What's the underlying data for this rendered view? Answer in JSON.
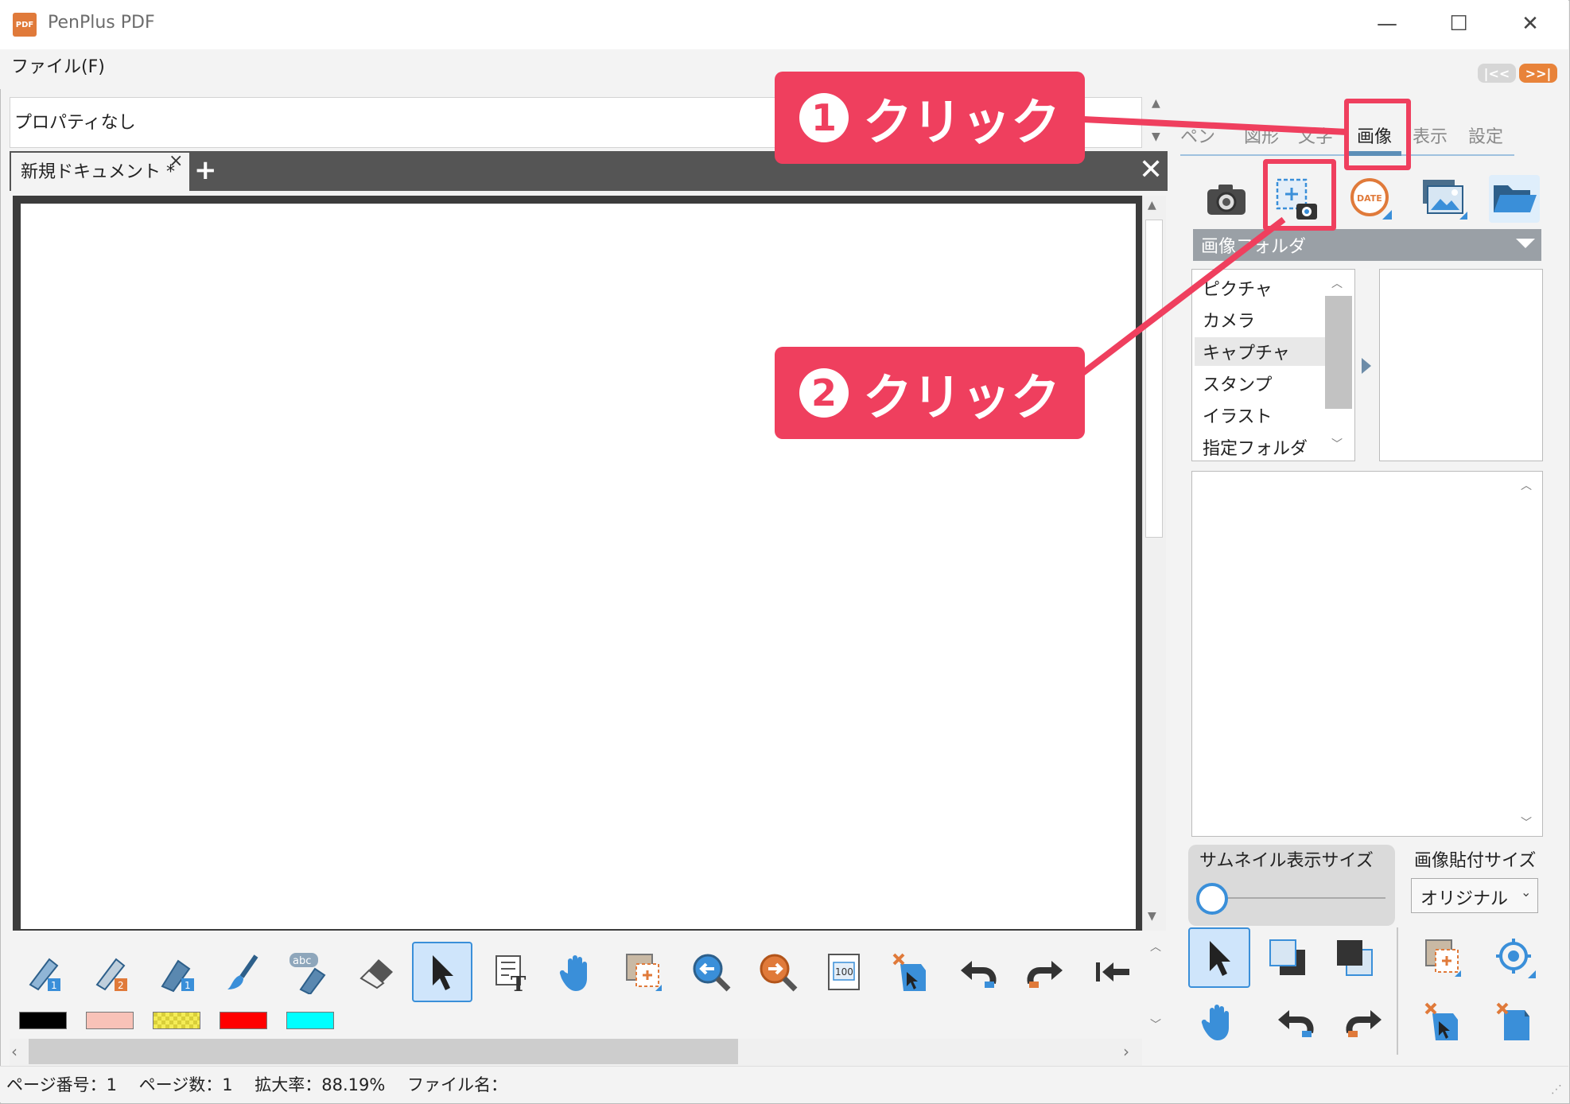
{
  "window": {
    "title": "PenPlus PDF",
    "app_icon_text": "PDF",
    "minimize": "—",
    "maximize": "☐",
    "close": "✕"
  },
  "menu": {
    "file": "ファイル(F)"
  },
  "nav": {
    "prev": "|<<",
    "next": ">>|"
  },
  "properties": {
    "text": "プロパティなし"
  },
  "document_tab": {
    "label": "新規ドキュメント *",
    "close": "×",
    "add": "+",
    "close_all": "✕"
  },
  "toolbar": {
    "tools": [
      "pen-1-icon",
      "pen-2-icon",
      "marker-1-icon",
      "brush-icon",
      "text-marker-icon",
      "eraser-icon",
      "select-arrow-icon",
      "text-box-icon",
      "hand-icon",
      "area-capture-icon",
      "zoom-out-icon",
      "zoom-in-icon",
      "fit-100-icon",
      "delete-object-icon",
      "undo-icon",
      "redo-icon",
      "go-first-icon"
    ],
    "swatches": [
      "#000000",
      "#f8c2b8",
      "#f4ec56",
      "#ff0000",
      "#00ffff"
    ]
  },
  "status": {
    "text": "ページ番号：1　 ページ数：1　 拡大率：88.19%　 ファイル名："
  },
  "panel": {
    "tabs": [
      "ペン",
      "図形",
      "文字",
      "画像",
      "表示",
      "設定"
    ],
    "active_tab": "画像",
    "image_tools": [
      "camera-icon",
      "screen-capture-icon",
      "date-stamp-icon",
      "image-gallery-icon",
      "open-folder-icon"
    ],
    "folder_header": "画像フォルダ",
    "folders": [
      "ピクチャ",
      "カメラ",
      "キャプチャ",
      "スタンプ",
      "イラスト",
      "指定フォルダ"
    ],
    "selected_folder": "キャプチャ",
    "thumbnail_size_label": "サムネイル表示サイズ",
    "thumbnail_size_value": 0,
    "paste_size_label": "画像貼付サイズ",
    "paste_size_value": "オリジナル",
    "tools": [
      "select-arrow-icon",
      "bring-front-icon",
      "send-back-icon",
      "area-capture-icon",
      "target-icon",
      "hand-icon",
      "undo-icon",
      "redo-icon",
      "delete-object-icon",
      "delete-page-icon"
    ]
  },
  "callouts": [
    {
      "num": "1",
      "text": "クリック"
    },
    {
      "num": "2",
      "text": "クリック"
    }
  ],
  "colors": {
    "callout": "#ef3f5e",
    "accent": "#3a8fd9"
  }
}
